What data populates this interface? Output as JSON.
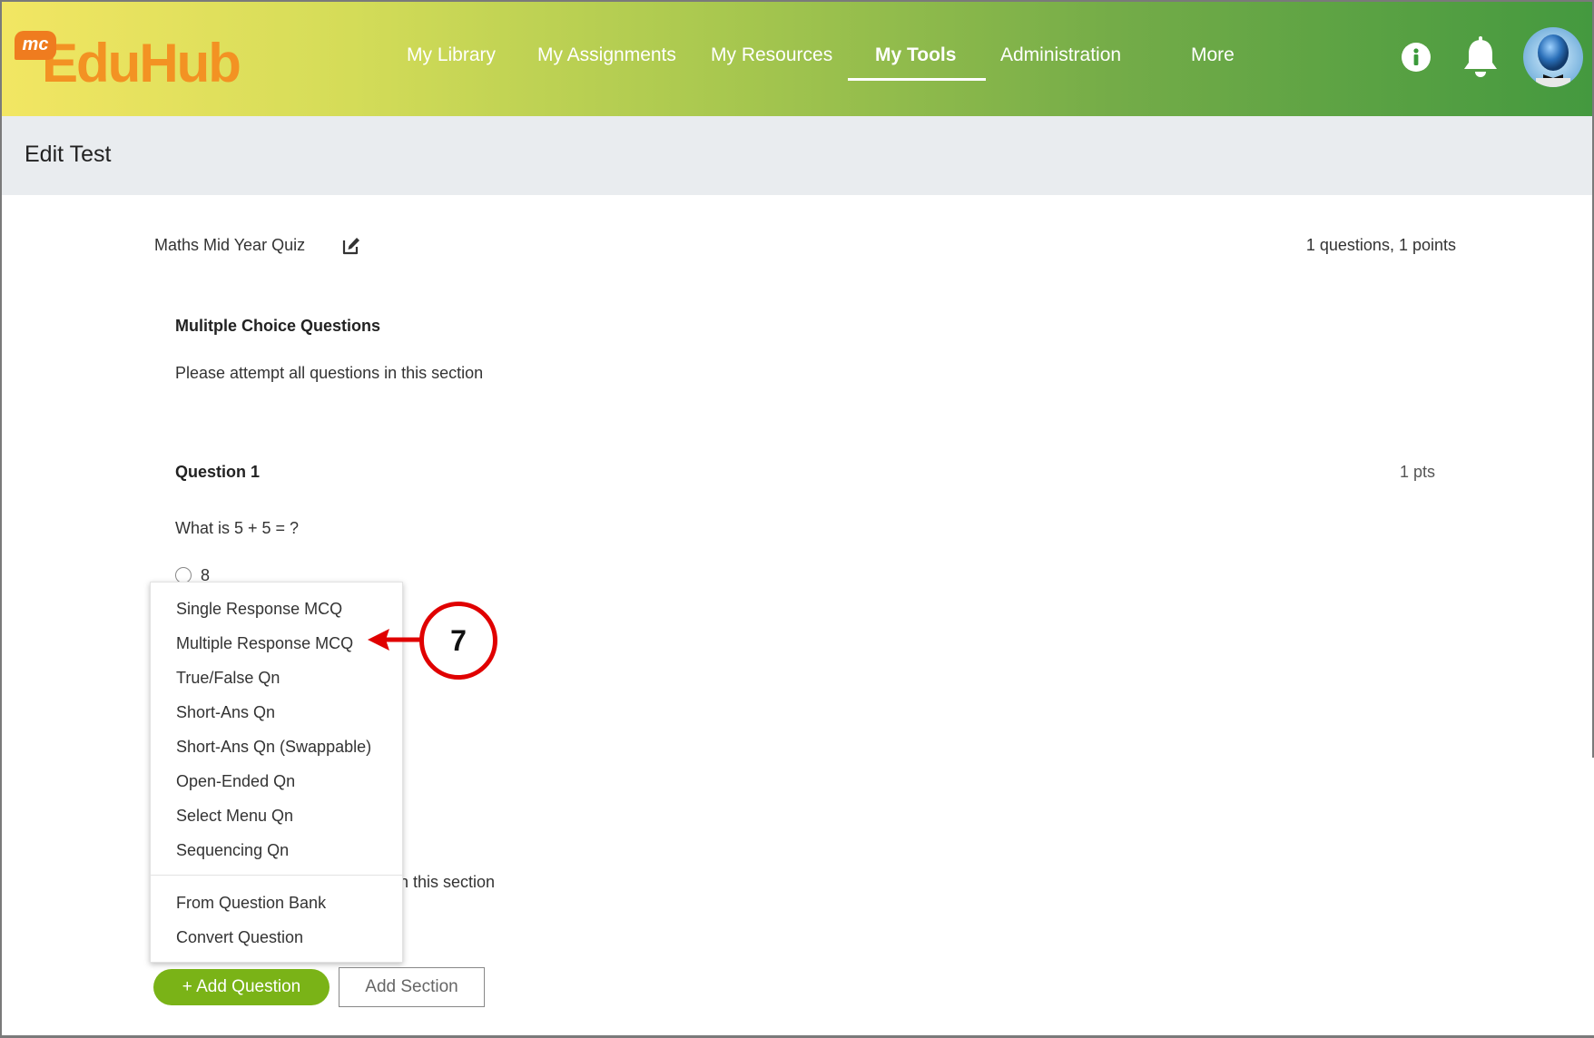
{
  "header": {
    "logo_badge": "mc",
    "logo_text": "EduHub",
    "nav": [
      {
        "label": "My Library"
      },
      {
        "label": "My Assignments"
      },
      {
        "label": "My Resources"
      },
      {
        "label": "My Tools"
      },
      {
        "label": "Administration"
      },
      {
        "label": "More"
      }
    ],
    "active_nav": "My Tools",
    "icons": [
      "info-icon",
      "bell-icon",
      "avatar"
    ]
  },
  "page": {
    "title": "Edit Test"
  },
  "test": {
    "name": "Maths Mid Year Quiz",
    "summary": "1 questions, 1 points",
    "section": {
      "title": "Mulitple Choice Questions",
      "description": "Please attempt all questions in this section",
      "description_partial": "n this section"
    },
    "question": {
      "title": "Question 1",
      "points": "1 pts",
      "text": "What is 5 + 5 = ?",
      "option_visible": "8"
    }
  },
  "menu": {
    "items": [
      "Single Response MCQ",
      "Multiple Response MCQ",
      "True/False Qn",
      "Short-Ans Qn",
      "Short-Ans Qn (Swappable)",
      "Open-Ended Qn",
      "Select Menu Qn",
      "Sequencing Qn"
    ],
    "extra_items": [
      "From Question Bank",
      "Convert Question"
    ]
  },
  "buttons": {
    "add_question": "+ Add Question",
    "add_section": "Add Section"
  },
  "callout": {
    "number": "7"
  },
  "colors": {
    "accent_green": "#7ab317",
    "callout_red": "#e00000",
    "logo_orange": "#f39223"
  }
}
